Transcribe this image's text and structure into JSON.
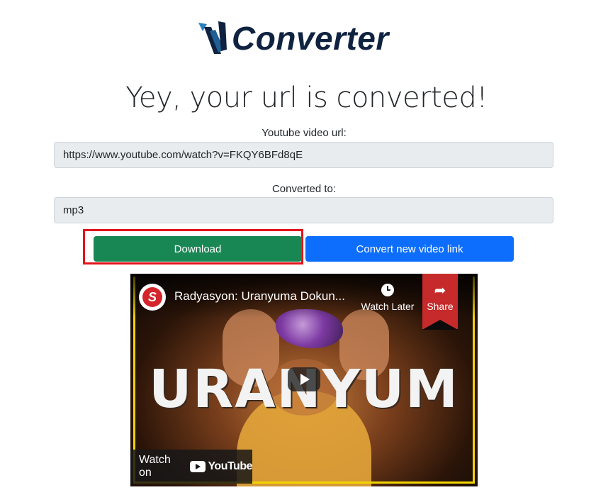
{
  "brand": {
    "logo_text": "Converter",
    "logo_mark": "yt-converter-logo"
  },
  "headline": "Yey, your url is converted!",
  "form": {
    "url_label": "Youtube video url:",
    "url_value": "https://www.youtube.com/watch?v=FKQY6BFd8qE",
    "format_label": "Converted to:",
    "format_value": "mp3"
  },
  "actions": {
    "download_label": "Download",
    "convert_new_label": "Convert new video link"
  },
  "video": {
    "title": "Radyasyon: Uranyuma Dokun...",
    "thumbnail_text": "URANYUM",
    "watch_later_label": "Watch Later",
    "share_label": "Share",
    "watch_on_label": "Watch on",
    "youtube_label": "YouTube",
    "channel_initial": "S"
  },
  "colors": {
    "download": "#198754",
    "convert_new": "#0d6efd",
    "highlight": "#e3141c",
    "logo": "#0f2340"
  }
}
